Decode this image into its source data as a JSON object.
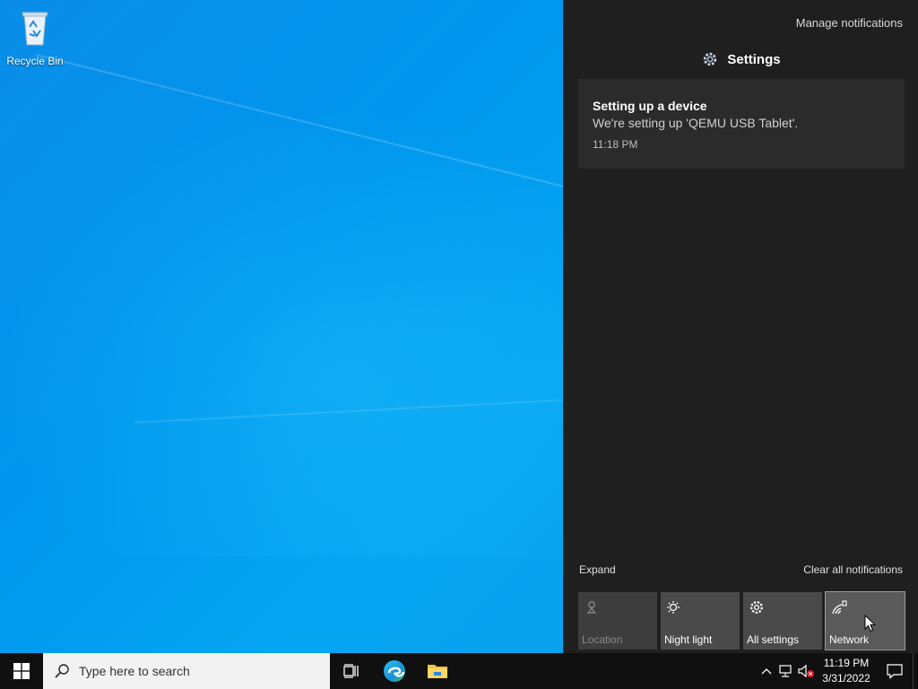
{
  "desktop": {
    "icons": [
      {
        "label": "Recycle Bin",
        "icon": "recycle-bin-icon"
      }
    ]
  },
  "action_center": {
    "manage_label": "Manage notifications",
    "group": {
      "app_name": "Settings",
      "icon": "gear-icon"
    },
    "notification": {
      "title": "Setting up a device",
      "body": "We're setting up 'QEMU USB Tablet'.",
      "time": "11:18 PM"
    },
    "expand_label": "Expand",
    "clear_label": "Clear all notifications",
    "quick_actions": [
      {
        "label": "Location",
        "icon": "location-icon",
        "state": "disabled"
      },
      {
        "label": "Night light",
        "icon": "night-light-icon",
        "state": "off"
      },
      {
        "label": "All settings",
        "icon": "gear-icon",
        "state": "off"
      },
      {
        "label": "Network",
        "icon": "network-icon",
        "state": "hover"
      }
    ]
  },
  "taskbar": {
    "search_placeholder": "Type here to search",
    "pinned": [
      {
        "name": "Task View",
        "icon": "task-view-icon"
      },
      {
        "name": "Microsoft Edge",
        "icon": "edge-icon"
      },
      {
        "name": "File Explorer",
        "icon": "folder-icon"
      }
    ],
    "tray": {
      "icons": [
        "chevron-up-icon",
        "network-icon",
        "volume-muted-icon"
      ],
      "time": "11:19 PM",
      "date": "3/31/2022"
    }
  },
  "colors": {
    "desktop_accent": "#0a8de8",
    "panel_bg": "#1f1f1f",
    "card_bg": "#2b2b2b",
    "tile_bg": "#4a4a4a",
    "taskbar_bg": "#101010"
  }
}
